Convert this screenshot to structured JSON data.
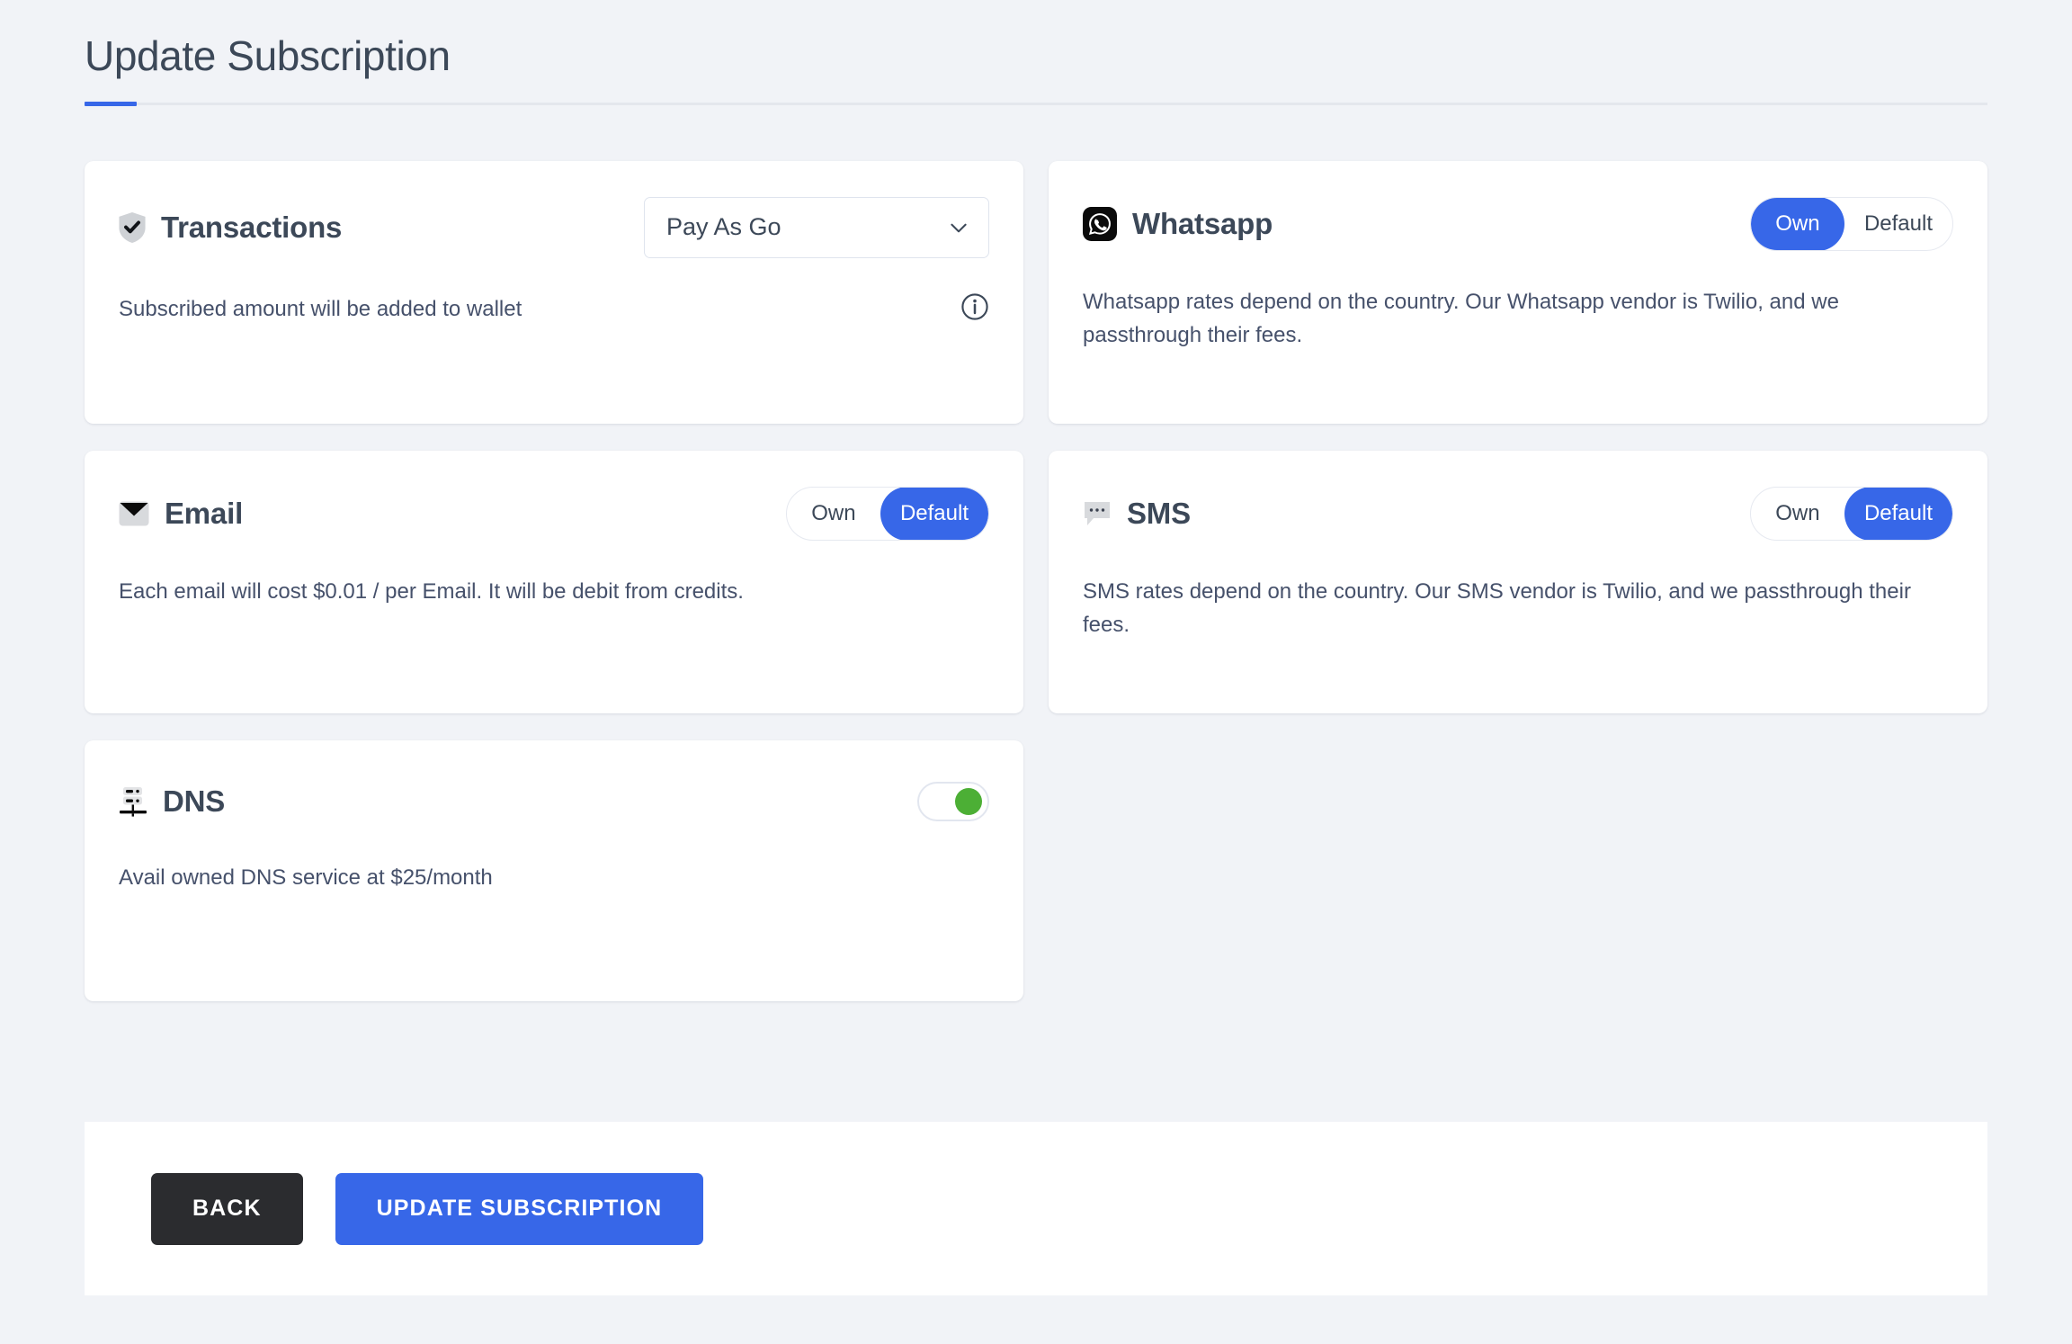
{
  "header": {
    "title": "Update Subscription",
    "accent_color": "#3767e8"
  },
  "cards": {
    "transactions": {
      "icon": "shield-check-icon",
      "title": "Transactions",
      "plan_select": {
        "value": "Pay As Go",
        "chevron": "chevron-down-icon"
      },
      "description": "Subscribed amount will be added to wallet",
      "info_icon": "info-circle-icon"
    },
    "whatsapp": {
      "icon": "whatsapp-icon",
      "title": "Whatsapp",
      "options": [
        "Own",
        "Default"
      ],
      "selected": "Own",
      "description": "Whatsapp rates depend on the country. Our Whatsapp vendor is Twilio, and we passthrough their fees."
    },
    "email": {
      "icon": "envelope-icon",
      "title": "Email",
      "options": [
        "Own",
        "Default"
      ],
      "selected": "Default",
      "description": "Each email will cost $0.01 / per Email. It will be debit from credits."
    },
    "sms": {
      "icon": "chat-bubble-icon",
      "title": "SMS",
      "options": [
        "Own",
        "Default"
      ],
      "selected": "Default",
      "description": "SMS rates depend on the country. Our SMS vendor is Twilio, and we passthrough their fees."
    },
    "dns": {
      "icon": "server-network-icon",
      "title": "DNS",
      "toggle_on": true,
      "toggle_color": "#4caf35",
      "description": "Avail owned DNS service at $25/month"
    }
  },
  "actions": {
    "back_label": "BACK",
    "update_label": "UPDATE SUBSCRIPTION"
  }
}
